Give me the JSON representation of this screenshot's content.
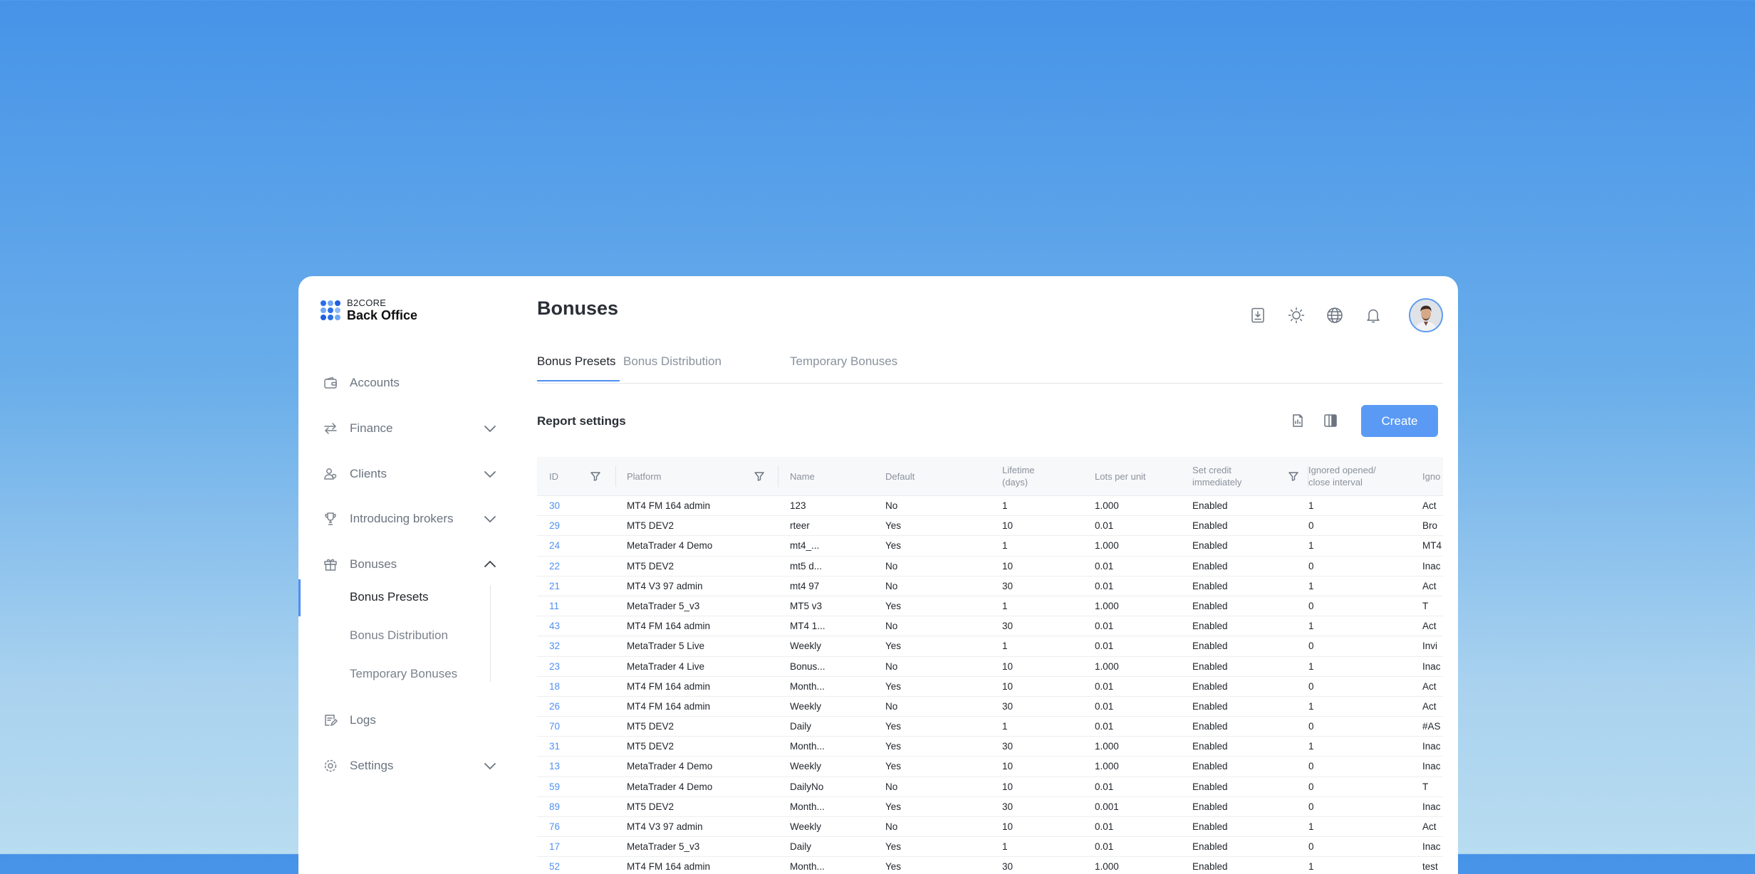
{
  "brand": {
    "top": "B2CORE",
    "bottom": "Back Office"
  },
  "sidebar": {
    "items": [
      {
        "label": "Accounts",
        "icon": "wallet-icon",
        "chevron": false
      },
      {
        "label": "Finance",
        "icon": "transfer-arrows-icon",
        "chevron": "down"
      },
      {
        "label": "Clients",
        "icon": "users-icon",
        "chevron": "down"
      },
      {
        "label": "Introducing brokers",
        "icon": "trophy-icon",
        "chevron": "down"
      },
      {
        "label": "Bonuses",
        "icon": "gift-icon",
        "chevron": "up"
      },
      {
        "label": "Logs",
        "icon": "logs-icon",
        "chevron": false
      },
      {
        "label": "Settings",
        "icon": "gear-icon",
        "chevron": "down"
      }
    ],
    "sub_items": [
      "Bonus Presets",
      "Bonus Distribution",
      "Temporary Bonuses"
    ]
  },
  "page": {
    "title": "Bonuses"
  },
  "tabs": [
    "Bonus Presets",
    "Bonus Distribution",
    "Temporary Bonuses"
  ],
  "report": {
    "title": "Report settings",
    "create_label": "Create"
  },
  "colors": {
    "accent": "#4f8ff2",
    "button": "#5a9af4"
  },
  "table": {
    "headers": [
      "ID",
      "Platform",
      "Name",
      "Default",
      "Lifetime\n(days)",
      "Lots per unit",
      "Set credit\nimmediately",
      "Ignored opened/\nclose interval",
      "Igno"
    ],
    "rows": [
      [
        "30",
        "MT4 FM 164 admin",
        "123",
        "No",
        "1",
        "1.000",
        "Enabled",
        "1",
        "Act"
      ],
      [
        "29",
        "MT5 DEV2",
        "rteer",
        "Yes",
        "10",
        "0.01",
        "Enabled",
        "0",
        "Bro"
      ],
      [
        "24",
        "MetaTrader 4 Demo",
        "mt4_...",
        "Yes",
        "1",
        "1.000",
        "Enabled",
        "1",
        "MT4"
      ],
      [
        "22",
        "MT5 DEV2",
        "mt5 d...",
        "No",
        "10",
        "0.01",
        "Enabled",
        "0",
        "Inac"
      ],
      [
        "21",
        "MT4 V3 97 admin",
        "mt4 97",
        "No",
        "30",
        "0.01",
        "Enabled",
        "1",
        "Act"
      ],
      [
        "11",
        "MetaTrader 5_v3",
        "MT5 v3",
        "Yes",
        "1",
        "1.000",
        "Enabled",
        "0",
        "T"
      ],
      [
        "43",
        "MT4 FM 164 admin",
        "MT4 1...",
        "No",
        "30",
        "0.01",
        "Enabled",
        "1",
        "Act"
      ],
      [
        "32",
        "MetaTrader 5 Live",
        "Weekly",
        "Yes",
        "1",
        "0.01",
        "Enabled",
        "0",
        "Invi"
      ],
      [
        "23",
        "MetaTrader 4 Live",
        "Bonus...",
        "No",
        "10",
        "1.000",
        "Enabled",
        "1",
        "Inac"
      ],
      [
        "18",
        "MT4 FM 164 admin",
        "Month...",
        "Yes",
        "10",
        "0.01",
        "Enabled",
        "0",
        "Act"
      ],
      [
        "26",
        "MT4 FM 164 admin",
        "Weekly",
        "No",
        "30",
        "0.01",
        "Enabled",
        "1",
        "Act"
      ],
      [
        "70",
        "MT5 DEV2",
        "Daily",
        "Yes",
        "1",
        "0.01",
        "Enabled",
        "0",
        "#AS"
      ],
      [
        "31",
        "MT5 DEV2",
        "Month...",
        "Yes",
        "30",
        "1.000",
        "Enabled",
        "1",
        "Inac"
      ],
      [
        "13",
        "MetaTrader 4 Demo",
        "Weekly",
        "Yes",
        "10",
        "1.000",
        "Enabled",
        "0",
        "Inac"
      ],
      [
        "59",
        "MetaTrader 4 Demo",
        "DailyNo",
        "No",
        "10",
        "0.01",
        "Enabled",
        "0",
        "T"
      ],
      [
        "89",
        "MT5 DEV2",
        "Month...",
        "Yes",
        "30",
        "0.001",
        "Enabled",
        "0",
        "Inac"
      ],
      [
        "76",
        "MT4 V3 97 admin",
        "Weekly",
        "No",
        "10",
        "0.01",
        "Enabled",
        "1",
        "Act"
      ],
      [
        "17",
        "MetaTrader 5_v3",
        "Daily",
        "Yes",
        "1",
        "0.01",
        "Enabled",
        "0",
        "Inac"
      ],
      [
        "52",
        "MT4 FM 164 admin",
        "Month...",
        "Yes",
        "30",
        "1.000",
        "Enabled",
        "1",
        "test"
      ]
    ]
  }
}
